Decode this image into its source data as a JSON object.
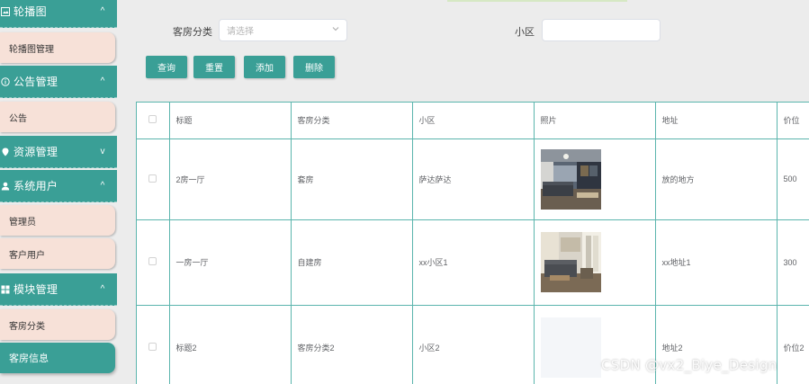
{
  "sidebar": {
    "groups": [
      {
        "label": "轮播图",
        "icon": "image-icon",
        "chevron": "^",
        "items": [
          "轮播图管理"
        ]
      },
      {
        "label": "公告管理",
        "icon": "info-circle-icon",
        "chevron": "^",
        "items": [
          "公告"
        ]
      },
      {
        "label": "资源管理",
        "icon": "location-pin-icon",
        "chevron": "v",
        "items": []
      },
      {
        "label": "系统用户",
        "icon": "user-icon",
        "chevron": "^",
        "items": [
          "管理员",
          "客户用户"
        ]
      },
      {
        "label": "模块管理",
        "icon": "grid-icon",
        "chevron": "^",
        "items": [
          "客房分类",
          "客房信息"
        ]
      }
    ],
    "active_item": "客房信息"
  },
  "filters": {
    "category_label": "客房分类",
    "category_placeholder": "请选择",
    "community_label": "小区",
    "community_value": ""
  },
  "buttons": {
    "query": "查询",
    "reset": "重置",
    "add": "添加",
    "delete": "删除"
  },
  "table": {
    "columns": [
      "标题",
      "客房分类",
      "小区",
      "照片",
      "地址",
      "价位"
    ],
    "rows": [
      {
        "title": "2房一厅",
        "category": "套房",
        "community": "萨达萨达",
        "photo": "living-room-photo-dark",
        "address": "放的地方",
        "price": "500"
      },
      {
        "title": "一房一厅",
        "category": "自建房",
        "community": "xx小区1",
        "photo": "living-room-photo-bright",
        "address": "xx地址1",
        "price": "300"
      },
      {
        "title": "标题2",
        "category": "客房分类2",
        "community": "小区2",
        "photo": "photo-placeholder",
        "address": "地址2",
        "price": "价位2"
      }
    ]
  },
  "watermark": "CSDN @vx2_Biye_Design",
  "colors": {
    "primary": "#3a9f96",
    "menu_item_bg": "#f7e1d8",
    "page_bg": "#ececec",
    "table_border": "#5bb5ad"
  }
}
